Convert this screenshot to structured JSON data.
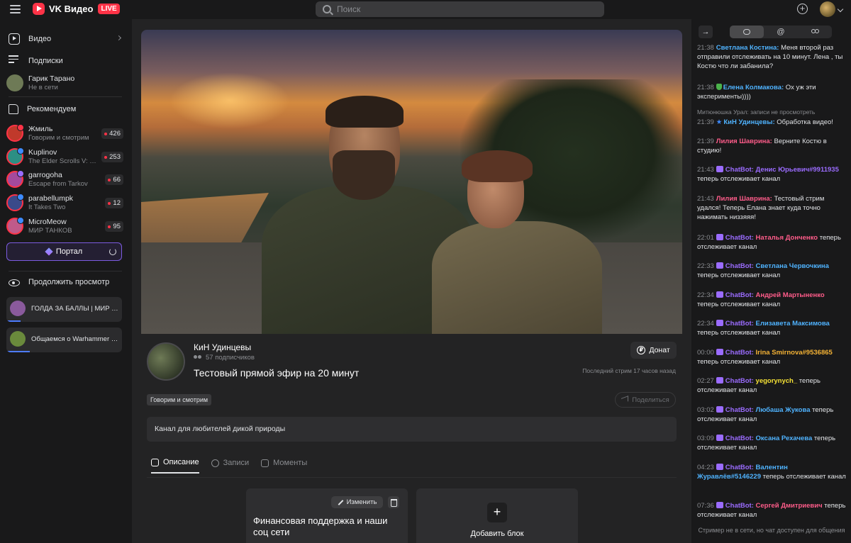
{
  "topbar": {
    "brand": "VK Видео",
    "live_badge": "LIVE",
    "search_placeholder": "Поиск"
  },
  "sidebar": {
    "nav": [
      {
        "label": "Видео",
        "icon": "video-icon"
      },
      {
        "label": "Подписки",
        "icon": "subscriptions-icon"
      }
    ],
    "profile": {
      "name": "Гарик Тарано",
      "status": "Не в сети"
    },
    "recommended_label": "Рекомендуем",
    "channels": [
      {
        "name": "Жмиль",
        "sub": "Говорим и смотрим",
        "viewers": "426",
        "avatar_color": "#c0392b",
        "dot_color": "#ff3347"
      },
      {
        "name": "Kuplinov",
        "sub": "The Elder Scrolls V: Sk...",
        "viewers": "253",
        "avatar_color": "#2c8f84",
        "dot_color": "#3d8bff"
      },
      {
        "name": "garrogoha",
        "sub": "Escape from Tarkov",
        "viewers": "66",
        "avatar_color": "#a44a9c",
        "dot_color": "#9b6cff"
      },
      {
        "name": "parabellumpk",
        "sub": "It Takes Two",
        "viewers": "12",
        "avatar_color": "#3b4a8a",
        "dot_color": "#3d8bff"
      },
      {
        "name": "MicroMeow",
        "sub": "МИР ТАНКОВ",
        "viewers": "95",
        "avatar_color": "#c05a8a",
        "dot_color": "#3d8bff"
      }
    ],
    "portal_label": "Портал",
    "continue_label": "Продолжить просмотр",
    "continue_items": [
      {
        "title": "ГОЛДА ЗА БАЛЛЫ | МИР Т...",
        "thumb_color": "#8a5a9c",
        "progress": 0.12
      },
      {
        "title": "Общаемся о Warhammer 4...",
        "thumb_color": "#6a8a3c",
        "progress": 0.2
      }
    ]
  },
  "main": {
    "channel_name": "КиН Удинцевы",
    "subscribers": "57 подписчиков",
    "stream_title": "Тестовый прямой эфир на 20 минут",
    "donate_label": "Донат",
    "last_stream": "Последний стрим 17 часов назад",
    "tag": "Говорим и смотрим",
    "share_label": "Поделиться",
    "description": "Канал для любителей дикой природы",
    "tabs": [
      {
        "label": "Описание",
        "active": true
      },
      {
        "label": "Записи",
        "active": false
      },
      {
        "label": "Моменты",
        "active": false
      }
    ],
    "block": {
      "edit_label": "Изменить",
      "title": "Финансовая поддержка и наши соц сети"
    },
    "add_block_label": "Добавить блок"
  },
  "chat": {
    "messages": [
      {
        "time": "21:38",
        "author": "Светлана Костина:",
        "color": "#4fb3ff",
        "text": "Меня второй раз отправили отслеживать на 10 минут. Лена , ты Костю что ли забанила?",
        "badge": ""
      },
      {
        "time": "21:38",
        "author": "Елена Колмакова:",
        "color": "#4fb3ff",
        "text": "Ох уж эти эксперименты))))",
        "badge": "shield"
      },
      {
        "time": "21:39",
        "author": "КиН Удинцевы:",
        "color": "#4fb3ff",
        "text": "Обработка видео!",
        "badge": "star",
        "reply": "Митюнюшка Урал: записи не просмотреть"
      },
      {
        "time": "21:39",
        "author": "Лилия Шаврина:",
        "color": "#ff5c8a",
        "text": "Верните Костю в студию!",
        "badge": ""
      },
      {
        "time": "21:43",
        "author": "ChatBot:",
        "color": "#9b6cff",
        "text": "теперь отслеживает канал",
        "mention": "Денис Юрьевич#9911935",
        "mention_color": "#9b6cff",
        "badge": "bot"
      },
      {
        "time": "21:43",
        "author": "Лилия Шаврина:",
        "color": "#ff5c8a",
        "text": "Тестовый стрим удался! Теперь Елана знает куда точно нажимать низзяяя!",
        "badge": ""
      },
      {
        "time": "22:01",
        "author": "ChatBot:",
        "color": "#9b6cff",
        "text": "теперь отслеживает канал",
        "mention": "Наталья Донченко",
        "mention_color": "#ff5c8a",
        "badge": "bot"
      },
      {
        "time": "22:33",
        "author": "ChatBot:",
        "color": "#9b6cff",
        "text": "теперь отслеживает канал",
        "mention": "Светлана Червочкина",
        "mention_color": "#4fb3ff",
        "badge": "bot"
      },
      {
        "time": "22:34",
        "author": "ChatBot:",
        "color": "#9b6cff",
        "text": "теперь отслеживает канал",
        "mention": "Андрей Мартыненко",
        "mention_color": "#ff5c8a",
        "badge": "bot"
      },
      {
        "time": "22:34",
        "author": "ChatBot:",
        "color": "#9b6cff",
        "text": "теперь отслеживает канал",
        "mention": "Елизавета Максимова",
        "mention_color": "#4fb3ff",
        "badge": "bot"
      },
      {
        "time": "00:00",
        "author": "ChatBot:",
        "color": "#9b6cff",
        "text": "теперь отслеживает канал",
        "mention": "Irina Smirnova#9536865",
        "mention_color": "#f5b335",
        "badge": "bot"
      },
      {
        "time": "02:27",
        "author": "ChatBot:",
        "color": "#9b6cff",
        "text": "теперь отслеживает канал",
        "mention": "yegorynych_",
        "mention_color": "#f5e135",
        "badge": "bot"
      },
      {
        "time": "03:02",
        "author": "ChatBot:",
        "color": "#9b6cff",
        "text": "теперь отслеживает канал",
        "mention": "Любаша Жукова",
        "mention_color": "#4fb3ff",
        "badge": "bot"
      },
      {
        "time": "03:09",
        "author": "ChatBot:",
        "color": "#9b6cff",
        "text": "теперь отслеживает канал",
        "mention": "Оксана Рехачева",
        "mention_color": "#4fb3ff",
        "badge": "bot"
      },
      {
        "time": "04:23",
        "author": "ChatBot:",
        "color": "#9b6cff",
        "text": "теперь отслеживает канал",
        "mention": "Валентин Журавлёв#5146229",
        "mention_color": "#4fb3ff",
        "badge": "bot"
      },
      {
        "time": "07:36",
        "author": "ChatBot:",
        "color": "#9b6cff",
        "text": "теперь отслеживает канал",
        "mention": "Сергей Дмитриевич",
        "mention_color": "#ff5c8a",
        "badge": "bot"
      }
    ],
    "footer": "Стример не в сети, но чат доступен для общения"
  }
}
